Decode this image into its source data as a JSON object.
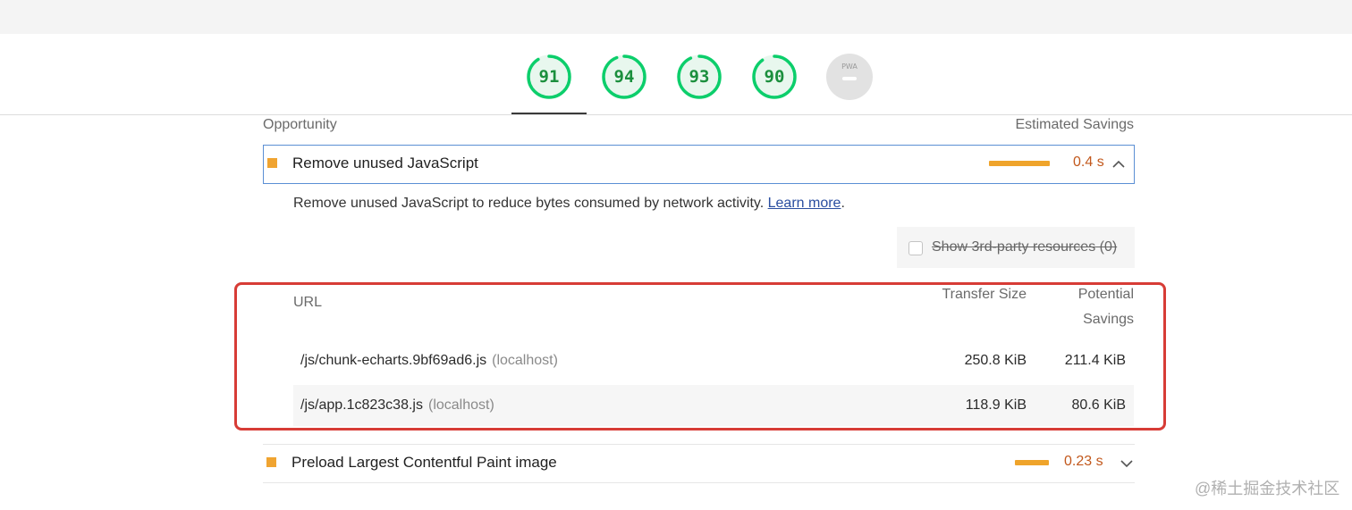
{
  "gauges": [
    {
      "label": "91",
      "score": 0.91
    },
    {
      "label": "94",
      "score": 0.94
    },
    {
      "label": "93",
      "score": 0.93
    },
    {
      "label": "90",
      "score": 0.9
    }
  ],
  "pwa": {
    "label": "PWA"
  },
  "columns": {
    "opportunity": "Opportunity",
    "savings": "Estimated Savings"
  },
  "audit_js": {
    "title": "Remove unused JavaScript",
    "saving": "0.4 s",
    "description": "Remove unused JavaScript to reduce bytes consumed by network activity. ",
    "learn_more": "Learn more",
    "description_end": "."
  },
  "third_party": {
    "label": "Show 3rd-party resources",
    "count": " (0)",
    "checked": false
  },
  "table": {
    "headers": {
      "url": "URL",
      "transfer_size": "Transfer Size",
      "potential_savings": "Potential Savings"
    },
    "rows": [
      {
        "url": "/js/chunk-echarts.9bf69ad6.js",
        "host": "(localhost)",
        "transfer": "250.8 KiB",
        "savings": "211.4 KiB"
      },
      {
        "url": "/js/app.1c823c38.js",
        "host": "(localhost)",
        "transfer": "118.9 KiB",
        "savings": "80.6 KiB"
      }
    ]
  },
  "audit_lcp": {
    "title": "Preload Largest Contentful Paint image",
    "saving": "0.23 s"
  },
  "watermark": "@稀土掘金技术社区",
  "colors": {
    "pass": "#0cce6b",
    "average": "#f0a431",
    "highlight": "#d73c36",
    "focus": "#5b8fd4"
  }
}
